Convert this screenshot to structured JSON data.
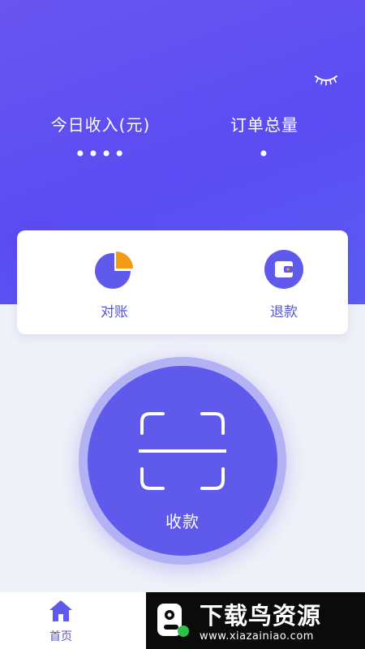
{
  "header": {
    "income_label": "今日收入(元)",
    "income_value": "••••",
    "orders_label": "订单总量",
    "orders_value": "•",
    "eye_icon": "eye-closed-icon"
  },
  "actions": [
    {
      "label": "对账",
      "icon": "pie-chart-icon"
    },
    {
      "label": "退款",
      "icon": "wallet-icon"
    }
  ],
  "scan": {
    "label": "收款",
    "icon": "scan-frame-icon"
  },
  "tabbar": {
    "home_label": "首页",
    "home_icon": "home-icon"
  },
  "watermark": {
    "title": "下载鸟资源",
    "url": "www.xiazainiao.com"
  },
  "colors": {
    "primary": "#5f59ec",
    "hero_start": "#6a55f0",
    "accent_orange": "#f59a14",
    "background": "#eef1f8",
    "label_purple": "#5a55c8"
  }
}
